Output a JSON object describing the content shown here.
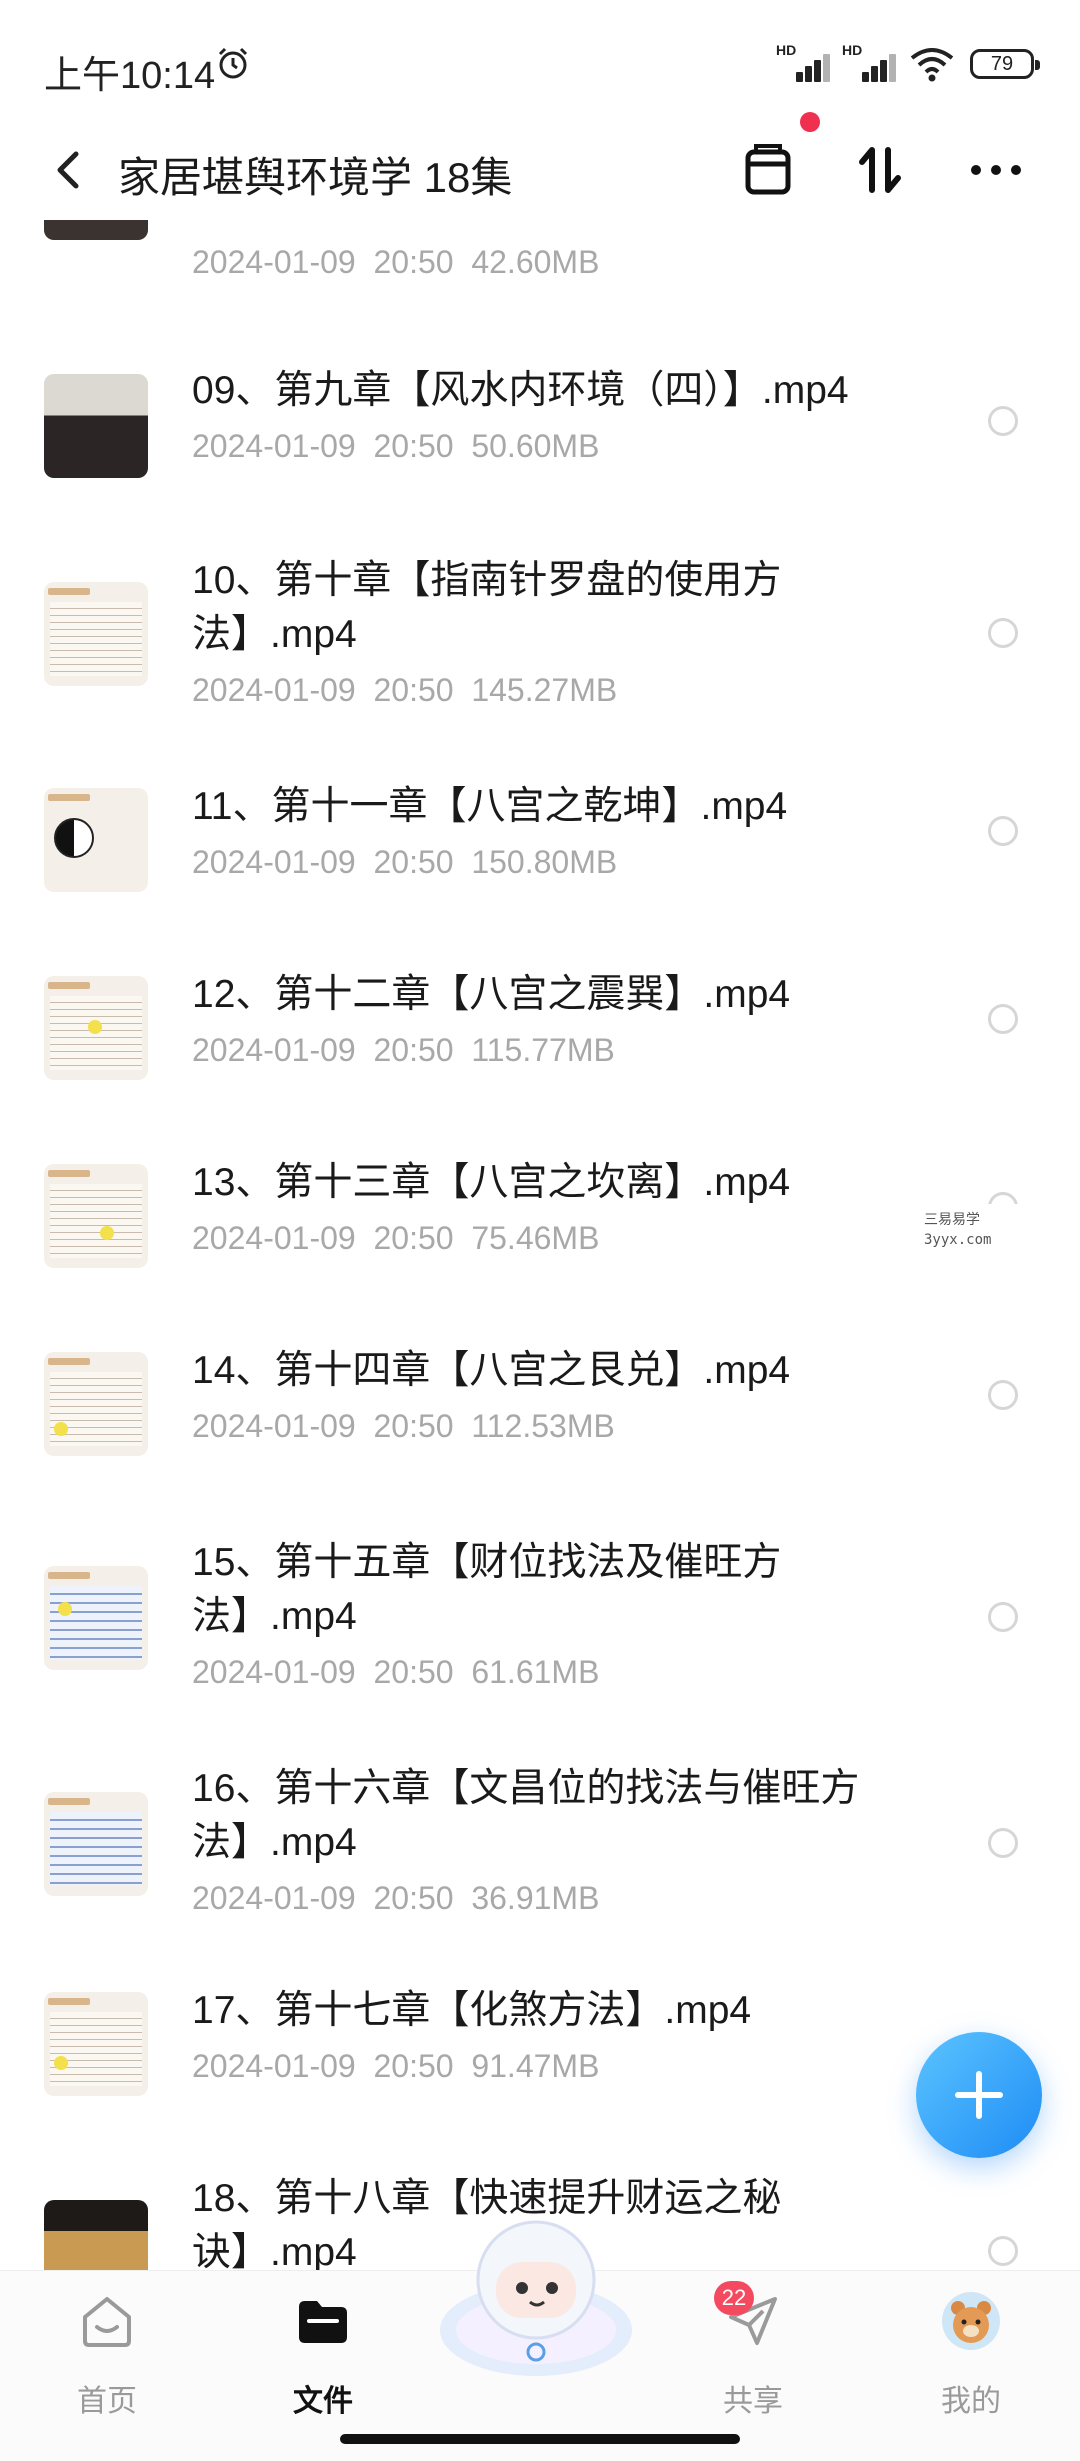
{
  "status_bar": {
    "time": "上午10:14",
    "signal_label": "HD",
    "battery": "79"
  },
  "header": {
    "title": "家居堪舆环境学 18集"
  },
  "files": [
    {
      "name": "",
      "date": "2024-01-09",
      "time": "20:50",
      "size": "42.60MB"
    },
    {
      "name": "09、第九章【风水内环境（四）】.mp4",
      "date": "2024-01-09",
      "time": "20:50",
      "size": "50.60MB"
    },
    {
      "name": "10、第十章【指南针罗盘的使用方法】.mp4",
      "date": "2024-01-09",
      "time": "20:50",
      "size": "145.27MB"
    },
    {
      "name": "11、第十一章【八宫之乾坤】.mp4",
      "date": "2024-01-09",
      "time": "20:50",
      "size": "150.80MB"
    },
    {
      "name": "12、第十二章【八宫之震巽】.mp4",
      "date": "2024-01-09",
      "time": "20:50",
      "size": "115.77MB"
    },
    {
      "name": "13、第十三章【八宫之坎离】.mp4",
      "date": "2024-01-09",
      "time": "20:50",
      "size": "75.46MB"
    },
    {
      "name": "14、第十四章【八宫之艮兑】.mp4",
      "date": "2024-01-09",
      "time": "20:50",
      "size": "112.53MB"
    },
    {
      "name": "15、第十五章【财位找法及催旺方法】.mp4",
      "date": "2024-01-09",
      "time": "20:50",
      "size": "61.61MB"
    },
    {
      "name": "16、第十六章【文昌位的找法与催旺方法】.mp4",
      "date": "2024-01-09",
      "time": "20:50",
      "size": "36.91MB"
    },
    {
      "name": "17、第十七章【化煞方法】.mp4",
      "date": "2024-01-09",
      "time": "20:50",
      "size": "91.47MB"
    },
    {
      "name": "18、第十八章【快速提升财运之秘诀】.mp4",
      "date": "",
      "time": "",
      "size": ""
    }
  ],
  "watermark": {
    "line1": "三易易学",
    "line2": "3yyx.com"
  },
  "bottom_nav": {
    "home": "首页",
    "files": "文件",
    "share": "共享",
    "share_badge": "22",
    "mine": "我的"
  }
}
